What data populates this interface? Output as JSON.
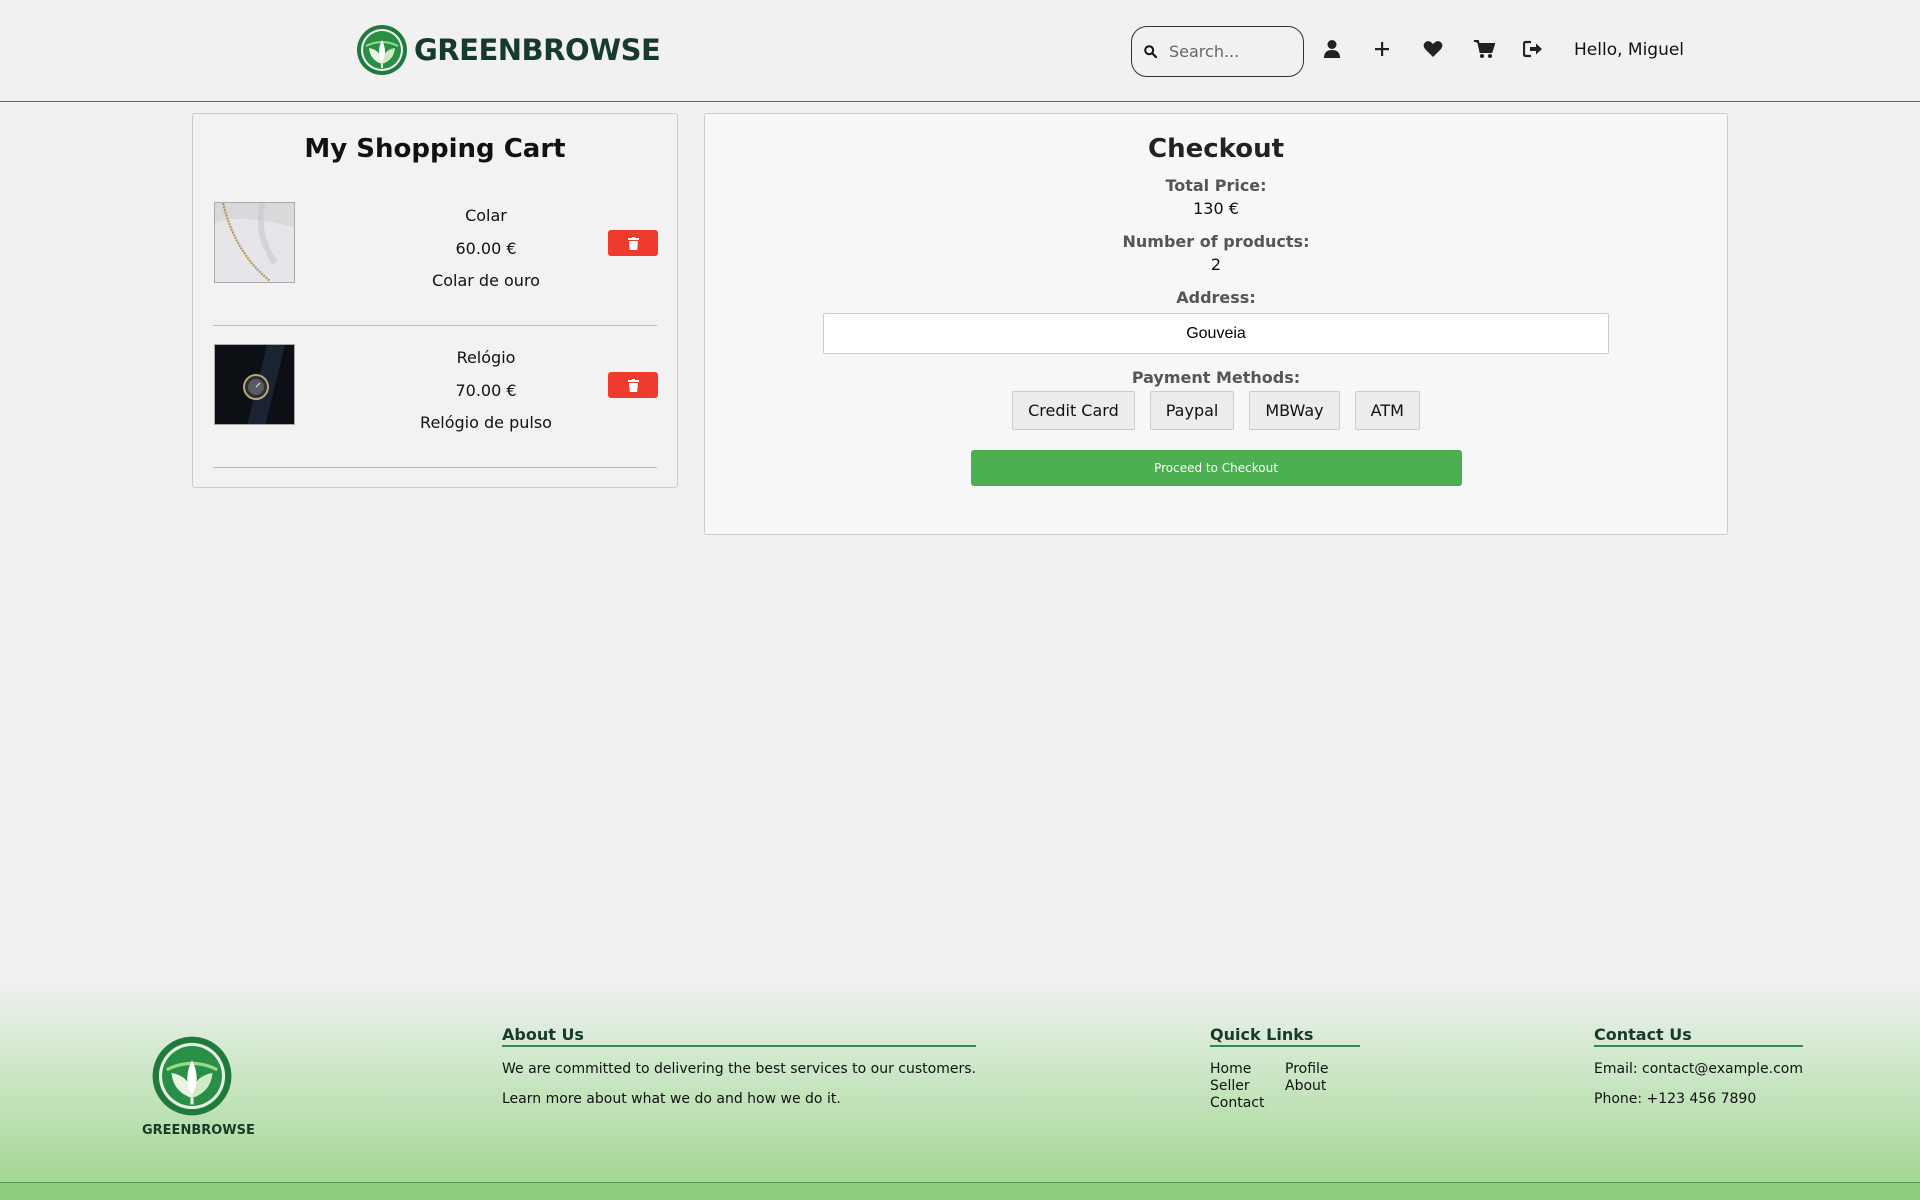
{
  "header": {
    "brand": "GREENBROWSE",
    "search_placeholder": "Search...",
    "greeting": "Hello, Miguel",
    "icons": [
      "user-icon",
      "plus-icon",
      "heart-icon",
      "cart-icon",
      "logout-icon"
    ]
  },
  "cart": {
    "title": "My Shopping Cart",
    "items": [
      {
        "name": "Colar",
        "price": "60.00 €",
        "description": "Colar de ouro"
      },
      {
        "name": "Relógio",
        "price": "70.00 €",
        "description": "Relógio de pulso"
      }
    ]
  },
  "checkout": {
    "title": "Checkout",
    "total_label": "Total Price:",
    "total_value": "130 €",
    "count_label": "Number of products:",
    "count_value": "2",
    "address_label": "Address:",
    "address_value": "Gouveia",
    "payment_label": "Payment Methods:",
    "payment_methods": [
      "Credit Card",
      "Paypal",
      "MBWay",
      "ATM"
    ],
    "proceed_label": "Proceed to Checkout"
  },
  "footer": {
    "brand": "GREENBROWSE",
    "about": {
      "title": "About Us",
      "line1": "We are committed to delivering the best services to our customers.",
      "line2": "Learn more about what we do and how we do it."
    },
    "quick_links": {
      "title": "Quick Links",
      "links": [
        "Home",
        "Profile",
        "Seller",
        "About",
        "Contact"
      ]
    },
    "contact": {
      "title": "Contact Us",
      "email": "Email: contact@example.com",
      "phone": "Phone: +123 456 7890"
    }
  },
  "colors": {
    "brand_dark": "#163b2a",
    "brand_green": "#2e8b57",
    "proceed_green": "#4caf50",
    "delete_red": "#ef3b2d"
  }
}
